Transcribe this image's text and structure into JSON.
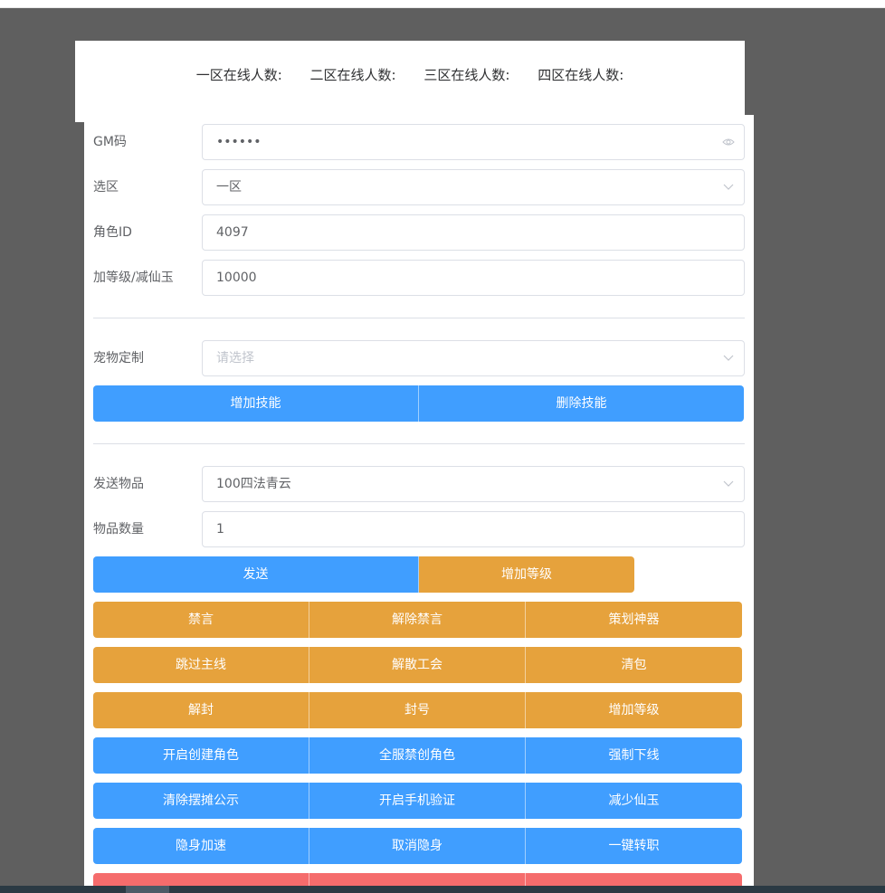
{
  "online": {
    "zone1": "一区在线人数:",
    "zone2": "二区在线人数:",
    "zone3": "三区在线人数:",
    "zone4": "四区在线人数:"
  },
  "form": {
    "gm_code": {
      "label": "GM码",
      "value": "••••••",
      "icon": "eye-icon"
    },
    "zone": {
      "label": "选区",
      "value": "一区",
      "icon": "chevron-down-icon"
    },
    "role_id": {
      "label": "角色ID",
      "value": "4097"
    },
    "level_jade": {
      "label": "加等级/减仙玉",
      "value": "10000"
    },
    "pet": {
      "label": "宠物定制",
      "placeholder": "请选择",
      "icon": "chevron-down-icon"
    },
    "item": {
      "label": "发送物品",
      "value": "100四法青云",
      "icon": "chevron-down-icon"
    },
    "quantity": {
      "label": "物品数量",
      "value": "1"
    }
  },
  "buttons": {
    "skill": [
      "增加技能",
      "删除技能"
    ],
    "send_row": [
      "发送",
      "增加等级"
    ],
    "row1": [
      "禁言",
      "解除禁言",
      "策划神器"
    ],
    "row2": [
      "跳过主线",
      "解散工会",
      "清包"
    ],
    "row3": [
      "解封",
      "封号",
      "增加等级"
    ],
    "row4": [
      "开启创建角色",
      "全服禁创角色",
      "强制下线"
    ],
    "row5": [
      "清除摆摊公示",
      "开启手机验证",
      "减少仙玉"
    ],
    "row6": [
      "隐身加速",
      "取消隐身",
      "一键转职"
    ]
  },
  "colors": {
    "primary": "#409eff",
    "warning": "#e6a23c",
    "danger": "#f56c6c",
    "backdrop": "#5f5f5f"
  }
}
